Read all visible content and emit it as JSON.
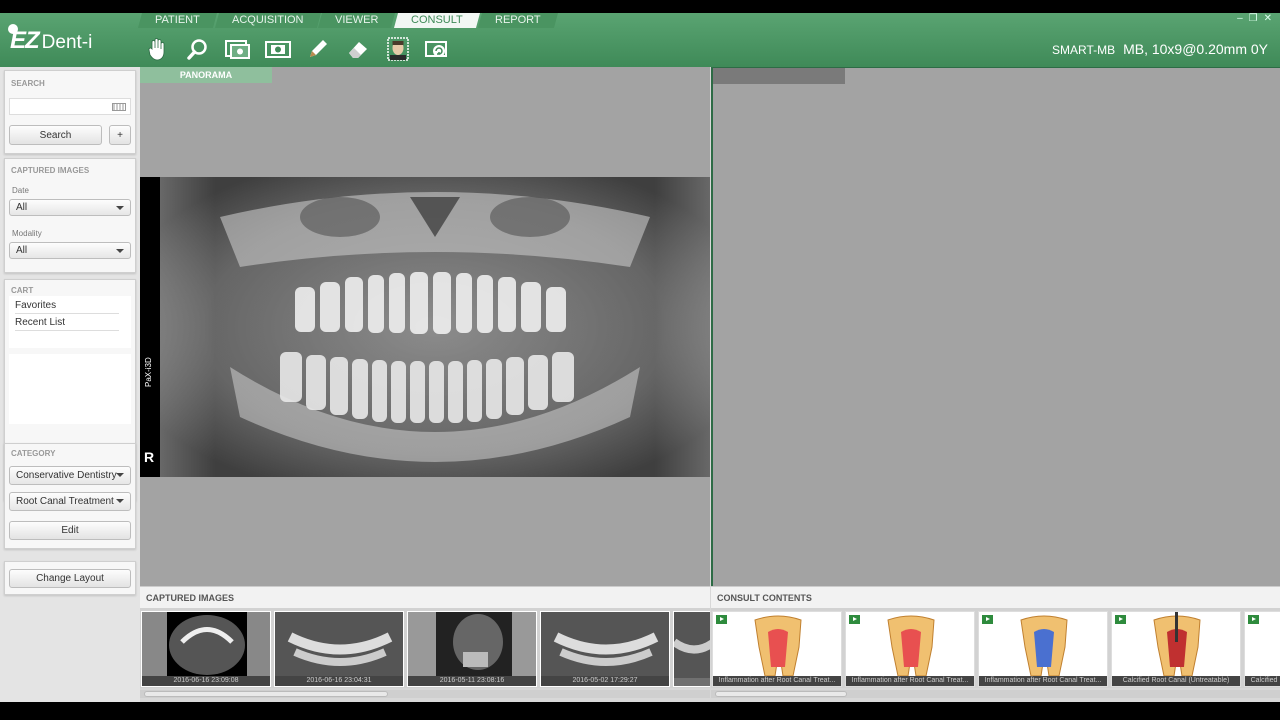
{
  "app": {
    "logo_ez": "EZ",
    "logo_dent": "Dent-i"
  },
  "tabs": [
    {
      "label": "PATIENT"
    },
    {
      "label": "ACQUISITION"
    },
    {
      "label": "VIEWER"
    },
    {
      "label": "CONSULT"
    },
    {
      "label": "REPORT"
    }
  ],
  "active_tab": "CONSULT",
  "toolbar": {
    "icons": [
      "hand-icon",
      "magnifier-icon",
      "photo-capture-icon",
      "camera-icon",
      "pen-icon",
      "eraser-icon",
      "face-icon",
      "rotate-camera-icon"
    ]
  },
  "device": {
    "name": "SMART-MB",
    "spec": "MB, 10x9@0.20mm 0Y"
  },
  "search": {
    "title": "SEARCH",
    "input_value": "",
    "button": "Search",
    "plus": "+"
  },
  "captured": {
    "title": "CAPTURED IMAGES",
    "date_label": "Date",
    "date_value": "All",
    "modality_label": "Modality",
    "modality_value": "All"
  },
  "cart": {
    "title": "CART",
    "items": [
      "Favorites",
      "Recent List"
    ]
  },
  "category": {
    "title": "CATEGORY",
    "select1": "Conservative Dentistry",
    "select2": "Root Canal Treatment",
    "edit": "Edit"
  },
  "layout_button": "Change Layout",
  "viewer": {
    "left_tab": "PANORAMA",
    "side_text": "PaX-i3D",
    "side_marker": "R"
  },
  "bottom": {
    "captured_title": "CAPTURED IMAGES",
    "captured_thumbs": [
      {
        "caption": "2016-06-16 23:09:08"
      },
      {
        "caption": "2016-06-16 23:04:31"
      },
      {
        "caption": "2016-05-11 23:08:16"
      },
      {
        "caption": "2016-05-02 17:29:27"
      }
    ],
    "consult_title": "CONSULT CONTENTS",
    "consult_thumbs": [
      {
        "caption": "Inflammation after Root Canal Treat..."
      },
      {
        "caption": "Inflammation after Root Canal Treat..."
      },
      {
        "caption": "Inflammation after Root Canal Treat..."
      },
      {
        "caption": "Calcified Root Canal (Untreatable)"
      },
      {
        "caption": "Calcified"
      }
    ]
  },
  "window_controls": {
    "minimize": "–",
    "restore": "❐",
    "close": "✕"
  }
}
